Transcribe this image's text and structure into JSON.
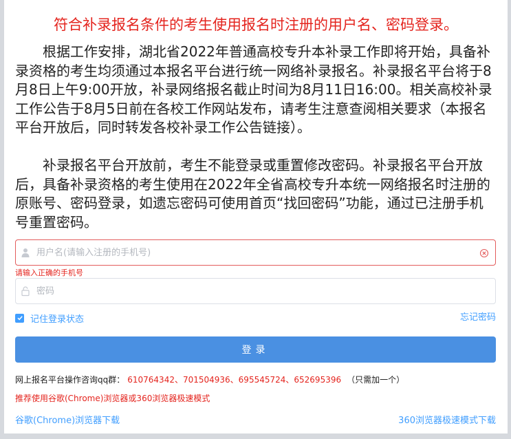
{
  "notice": {
    "title": "符合补录报名条件的考生使用报名时注册的用户名、密码登录。",
    "paragraph1": "根据工作安排，湖北省2022年普通高校专升本补录工作即将开始，具备补录资格的考生均须通过本报名平台进行统一网络补录报名。补录报名平台将于8月8日上午9:00开放，补录网络报名截止时间为8月11日16:00。相关高校补录工作公告于8月5日前在各校工作网站发布，请考生注意查阅相关要求（本报名平台开放后，同时转发各校补录工作公告链接）。",
    "paragraph2": "补录报名平台开放前，考生不能登录或重置修改密码。补录报名平台开放后，具备补录资格的考生使用在2022年全省高校专升本统一网络报名时注册的原账号、密码登录，如遗忘密码可使用首页“找回密码”功能，通过已注册手机号重置密码。"
  },
  "form": {
    "username": {
      "placeholder": "用户名(请输入注册的手机号)",
      "value": "",
      "error": "请输入正确的手机号"
    },
    "password": {
      "placeholder": "密码",
      "value": ""
    },
    "remember_label": "记住登录状态",
    "remember_checked": true,
    "forgot_label": "忘记密码",
    "login_label": "登录"
  },
  "footer": {
    "qq_label": "网上报名平台操作咨询qq群：",
    "qq_numbers": "610764342、701504936、695545724、652695396",
    "qq_note": "（只需加一个）",
    "recommend": "推荐使用谷歌(Chrome)浏览器或360浏览器极速模式",
    "chrome_download": "谷歌(Chrome)浏览器下载",
    "browser360_download": "360浏览器极速模式下载"
  },
  "colors": {
    "accent": "#409eff",
    "button": "#4a90e2",
    "alert": "#e4241e"
  },
  "icons": {
    "username": "user-icon",
    "password": "lock-icon",
    "clear": "circle-x-icon",
    "checkbox": "check-icon"
  }
}
